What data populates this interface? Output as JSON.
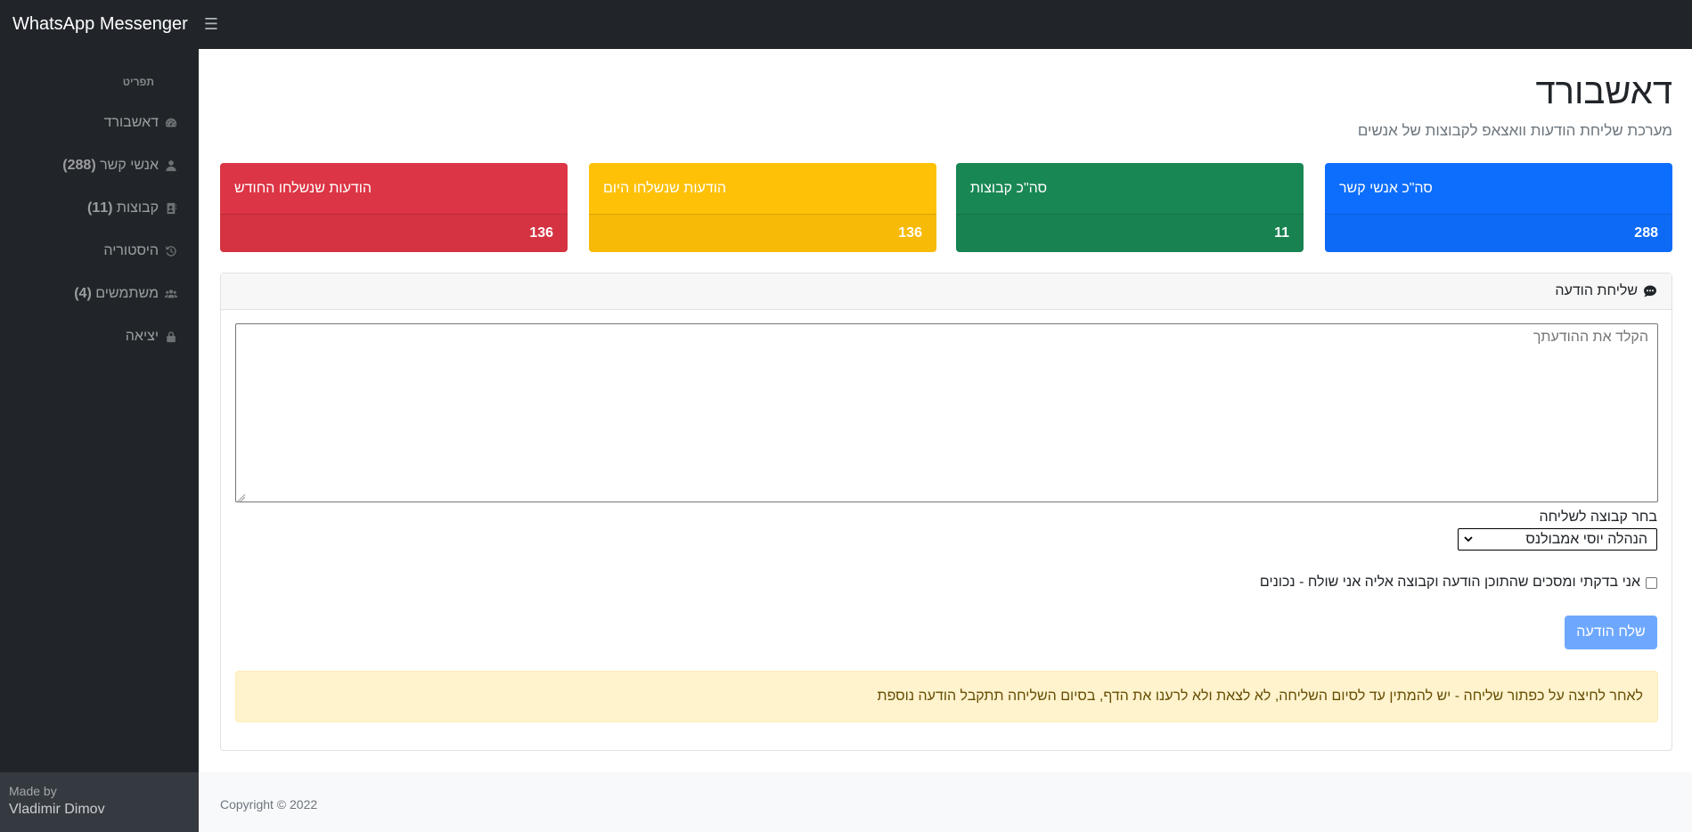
{
  "topbar": {
    "brand": "WhatsApp Messenger",
    "toggle_icon": "☰"
  },
  "sidebar": {
    "heading": "תפריט",
    "items": [
      {
        "label": "דאשבורד",
        "count": "",
        "icon": "dashboard-icon"
      },
      {
        "label": "אנשי קשר",
        "count": "(288)",
        "icon": "user-icon"
      },
      {
        "label": "קבוצות",
        "count": "(11)",
        "icon": "address-book-icon"
      },
      {
        "label": "היסטוריה",
        "count": "",
        "icon": "history-icon"
      },
      {
        "label": "משתמשים",
        "count": "(4)",
        "icon": "users-icon"
      },
      {
        "label": "יציאה",
        "count": "",
        "icon": "lock-icon"
      }
    ],
    "footer": {
      "made_by": "Made by",
      "author": "Vladimir Dimov"
    }
  },
  "header": {
    "title": "דאשבורד",
    "subtitle": "מערכת שליחת הודעות וואצאפ לקבוצות של אנשים"
  },
  "cards": [
    {
      "label": "סה\"כ אנשי קשר",
      "value": "288",
      "color": "#0d6efd"
    },
    {
      "label": "סה\"כ קבוצות",
      "value": "11",
      "color": "#198754"
    },
    {
      "label": "הודעות שנשלחו היום",
      "value": "136",
      "color": "#ffc107"
    },
    {
      "label": "הודעות שנשלחו החודש",
      "value": "136",
      "color": "#dc3545"
    }
  ],
  "send_panel": {
    "title": "שליחת הודעה",
    "message_value": "",
    "message_placeholder": "הקלד את ההודעתך",
    "group_label": "בחר קבוצה לשליחה",
    "group_selected": "הנהלה יוסי אמבולנס",
    "confirm_label": "אני בדקתי ומסכים שהתוכן הודעה וקבוצה אליה אני שולח - נכונים",
    "confirm_checked": false,
    "send_label": "שלח הודעה",
    "warning": "לאחר לחיצה על כפתור שליחה - יש להמתין עד לסיום השליחה, לא לצאת ולא לרענו את הדף, בסיום השליחה תתקבל הודעה נוספת"
  },
  "footer": {
    "copyright": "Copyright © 2022"
  }
}
